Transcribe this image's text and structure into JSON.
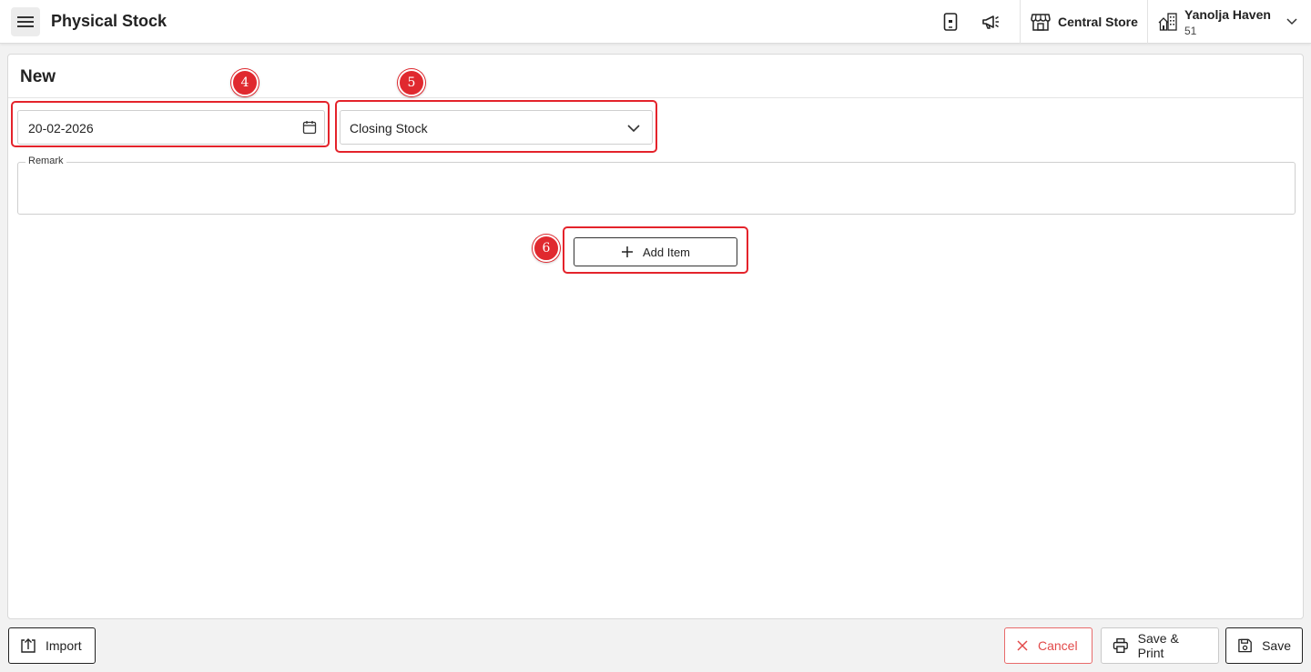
{
  "header": {
    "page_title": "Physical Stock",
    "store_name": "Central Store",
    "property_name": "Yanolja Haven",
    "property_code": "51"
  },
  "icons": {
    "menu": "hamburger-menu-icon",
    "mobile": "mobile-device-icon",
    "announcement": "megaphone-icon",
    "store": "storefront-icon",
    "property": "building-icon",
    "property_dropdown": "chevron-down-icon",
    "calendar": "calendar-icon",
    "type_dropdown": "chevron-down-icon",
    "add": "plus-icon",
    "import": "upload-icon",
    "cancel": "close-icon",
    "print": "printer-icon",
    "save": "floppy-disk-icon"
  },
  "form": {
    "title": "New",
    "date_value": "20-02-2026",
    "stock_type_value": "Closing Stock",
    "remark_label": "Remark",
    "remark_value": "",
    "add_item_label": "Add Item"
  },
  "annotations": {
    "date_badge": "4",
    "type_badge": "5",
    "add_item_badge": "6"
  },
  "footer": {
    "import_label": "Import",
    "cancel_label": "Cancel",
    "save_print_label": "Save & Print",
    "save_label": "Save"
  },
  "colors": {
    "annotation_red": "#e4232b",
    "cancel_red": "#e24a4a",
    "background": "#f2f2f2"
  }
}
